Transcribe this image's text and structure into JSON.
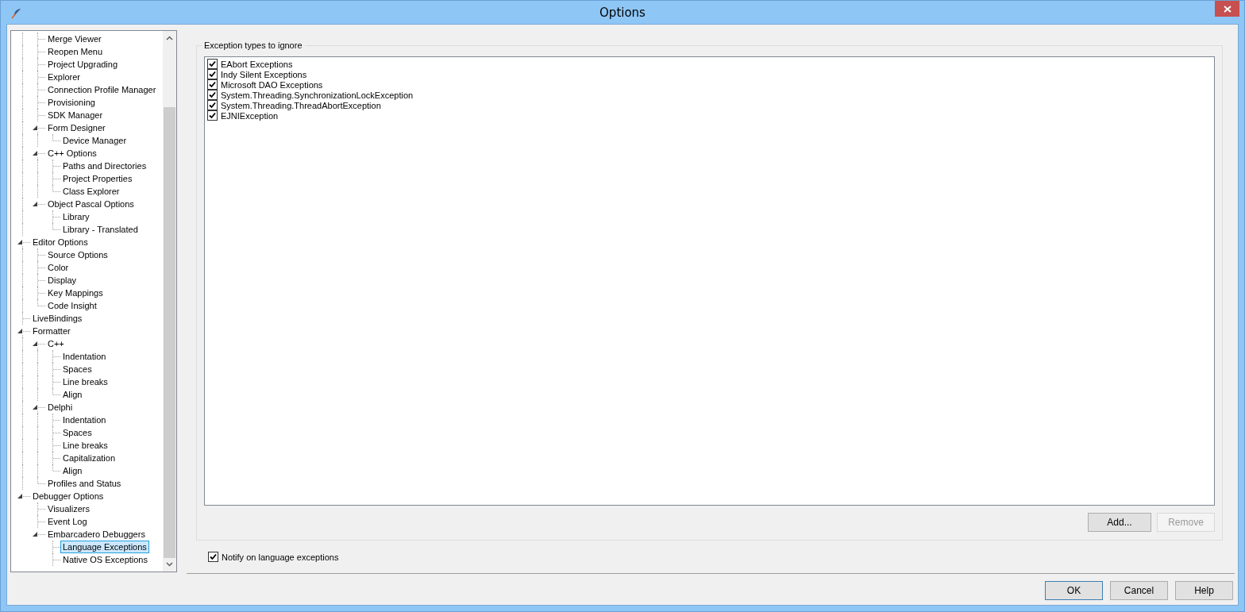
{
  "window": {
    "title": "Options"
  },
  "tree": {
    "scrolled_children": [
      {
        "label": "Merge Viewer",
        "selected": false
      },
      {
        "label": "Reopen Menu",
        "selected": false
      },
      {
        "label": "Project Upgrading",
        "selected": false
      },
      {
        "label": "Explorer",
        "selected": false
      },
      {
        "label": "Connection Profile Manager",
        "selected": false
      },
      {
        "label": "Provisioning",
        "selected": false
      },
      {
        "label": "SDK Manager",
        "selected": false
      },
      {
        "label": "Form Designer",
        "selected": false,
        "expanded": true,
        "children": [
          {
            "label": "Device Manager",
            "selected": false
          }
        ]
      },
      {
        "label": "C++ Options",
        "selected": false,
        "expanded": true,
        "children": [
          {
            "label": "Paths and Directories",
            "selected": false
          },
          {
            "label": "Project Properties",
            "selected": false
          },
          {
            "label": "Class Explorer",
            "selected": false
          }
        ]
      },
      {
        "label": "Object Pascal Options",
        "selected": false,
        "expanded": true,
        "children": [
          {
            "label": "Library",
            "selected": false
          },
          {
            "label": "Library - Translated",
            "selected": false
          }
        ]
      }
    ],
    "items": [
      {
        "label": "Editor Options",
        "selected": false,
        "expanded": true,
        "children": [
          {
            "label": "Source Options",
            "selected": false
          },
          {
            "label": "Color",
            "selected": false
          },
          {
            "label": "Display",
            "selected": false
          },
          {
            "label": "Key Mappings",
            "selected": false
          },
          {
            "label": "Code Insight",
            "selected": false
          }
        ]
      },
      {
        "label": "LiveBindings",
        "selected": false
      },
      {
        "label": "Formatter",
        "selected": false,
        "expanded": true,
        "children": [
          {
            "label": "C++",
            "selected": false,
            "expanded": true,
            "children": [
              {
                "label": "Indentation",
                "selected": false
              },
              {
                "label": "Spaces",
                "selected": false
              },
              {
                "label": "Line breaks",
                "selected": false
              },
              {
                "label": "Align",
                "selected": false
              }
            ]
          },
          {
            "label": "Delphi",
            "selected": false,
            "expanded": true,
            "children": [
              {
                "label": "Indentation",
                "selected": false
              },
              {
                "label": "Spaces",
                "selected": false
              },
              {
                "label": "Line breaks",
                "selected": false
              },
              {
                "label": "Capitalization",
                "selected": false
              },
              {
                "label": "Align",
                "selected": false
              }
            ]
          },
          {
            "label": "Profiles and Status",
            "selected": false
          }
        ]
      },
      {
        "label": "Debugger Options",
        "selected": false,
        "expanded": true,
        "children": [
          {
            "label": "Visualizers",
            "selected": false
          },
          {
            "label": "Event Log",
            "selected": false
          },
          {
            "label": "Embarcadero Debuggers",
            "selected": false,
            "expanded": true,
            "children": [
              {
                "label": "Language Exceptions",
                "selected": true
              },
              {
                "label": "Native OS Exceptions",
                "selected": false
              }
            ]
          }
        ]
      }
    ]
  },
  "exceptions_group": {
    "label": "Exception types to ignore",
    "items": [
      {
        "label": "EAbort Exceptions",
        "checked": true
      },
      {
        "label": "Indy Silent Exceptions",
        "checked": true
      },
      {
        "label": "Microsoft DAO Exceptions",
        "checked": true
      },
      {
        "label": "System.Threading.SynchronizationLockException",
        "checked": true
      },
      {
        "label": "System.Threading.ThreadAbortException",
        "checked": true
      },
      {
        "label": "EJNIException",
        "checked": true
      }
    ],
    "buttons": [
      {
        "label": "Add...",
        "disabled": false
      },
      {
        "label": "Remove",
        "disabled": true
      }
    ]
  },
  "notify": {
    "label": "Notify on language exceptions",
    "checked": true
  },
  "buttons": [
    {
      "label": "OK",
      "default": true
    },
    {
      "label": "Cancel",
      "default": false
    },
    {
      "label": "Help",
      "default": false
    }
  ]
}
